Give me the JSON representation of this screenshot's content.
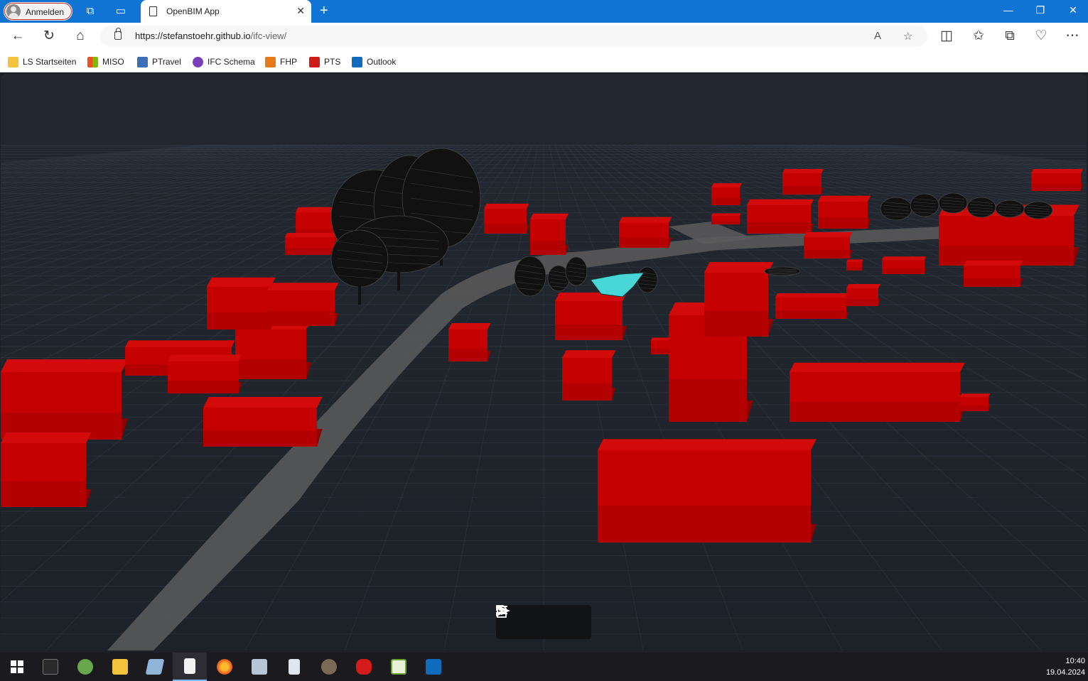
{
  "browser": {
    "profile_label": "Anmelden",
    "tab_title": "OpenBIM App",
    "url_host": "https://stefanstoehr.github.io",
    "url_path": "/ifc-view/",
    "favorites": [
      {
        "label": "LS Startseiten",
        "icon": "folder-icon",
        "color": "#f3c33b"
      },
      {
        "label": "MISO",
        "icon": "miso-icon",
        "color": "#2b7bd8"
      },
      {
        "label": "PTravel",
        "icon": "ptravel-icon",
        "color": "#3d6fb5"
      },
      {
        "label": "IFC Schema",
        "icon": "ifc-icon",
        "color": "#7a3fb8"
      },
      {
        "label": "FHP",
        "icon": "fhp-icon",
        "color": "#e77a1b"
      },
      {
        "label": "PTS",
        "icon": "pts-icon",
        "color": "#d01b1b"
      },
      {
        "label": "Outlook",
        "icon": "outlook-icon",
        "color": "#0f6cbd"
      }
    ]
  },
  "viewer": {
    "toolbar": [
      {
        "name": "open-file-button",
        "icon": "file-upload-icon"
      },
      {
        "name": "model-tree-button",
        "icon": "list-icon"
      },
      {
        "name": "send-button",
        "icon": "send-icon"
      }
    ],
    "colors": {
      "background": "#1f242b",
      "grid": "#3a4452",
      "building": "#c40000",
      "road": "#5a5a5a",
      "tree": "#111111",
      "selection": "#48d6d6"
    }
  },
  "taskbar": {
    "apps": [
      "windows-start-icon",
      "terminal-icon",
      "qgis-icon",
      "file-explorer-icon",
      "notes-icon",
      "document-icon",
      "firefox-icon",
      "cube-app-icon",
      "calculator-icon",
      "gimp-icon",
      "red-app-icon",
      "chart-app-icon",
      "outlook-icon"
    ],
    "time": "10:40",
    "date": "19.04.2024"
  }
}
